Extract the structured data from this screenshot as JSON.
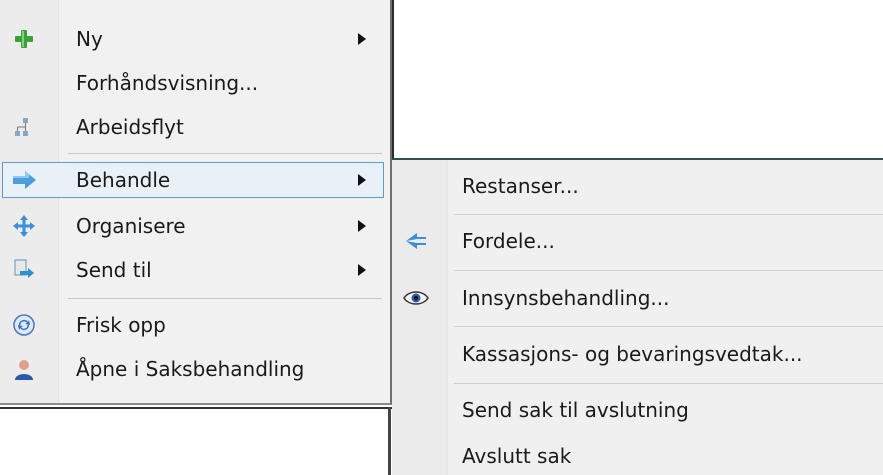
{
  "main_menu": {
    "items": [
      {
        "label": "Ny",
        "icon": "green-plus-icon",
        "submenu": true
      },
      {
        "label": "Forhåndsvisning...",
        "icon": "",
        "submenu": false
      },
      {
        "label": "Arbeidsflyt",
        "icon": "workflow-icon",
        "submenu": false
      },
      {
        "label": "Behandle",
        "icon": "process-arrow-icon",
        "submenu": true,
        "highlighted": true
      },
      {
        "label": "Organisere",
        "icon": "move-arrows-icon",
        "submenu": true
      },
      {
        "label": "Send til",
        "icon": "send-to-icon",
        "submenu": true
      },
      {
        "label": "Frisk opp",
        "icon": "refresh-icon",
        "submenu": false
      },
      {
        "label": "Åpne i Saksbehandling",
        "icon": "user-icon",
        "submenu": false
      }
    ]
  },
  "sub_menu": {
    "items": [
      {
        "label": "Restanser...",
        "icon": ""
      },
      {
        "label": "Fordele...",
        "icon": "distribute-icon"
      },
      {
        "label": "Innsynsbehandling...",
        "icon": "eye-icon"
      },
      {
        "label": "Kassasjons- og bevaringsvedtak...",
        "icon": ""
      },
      {
        "label": "Send sak til avslutning",
        "icon": ""
      },
      {
        "label": "Avslutt sak",
        "icon": ""
      }
    ]
  },
  "colors": {
    "highlight_border": "#5b9bd5",
    "highlight_bg": "#e8f0f8",
    "menu_bg": "#f1f1f1"
  }
}
